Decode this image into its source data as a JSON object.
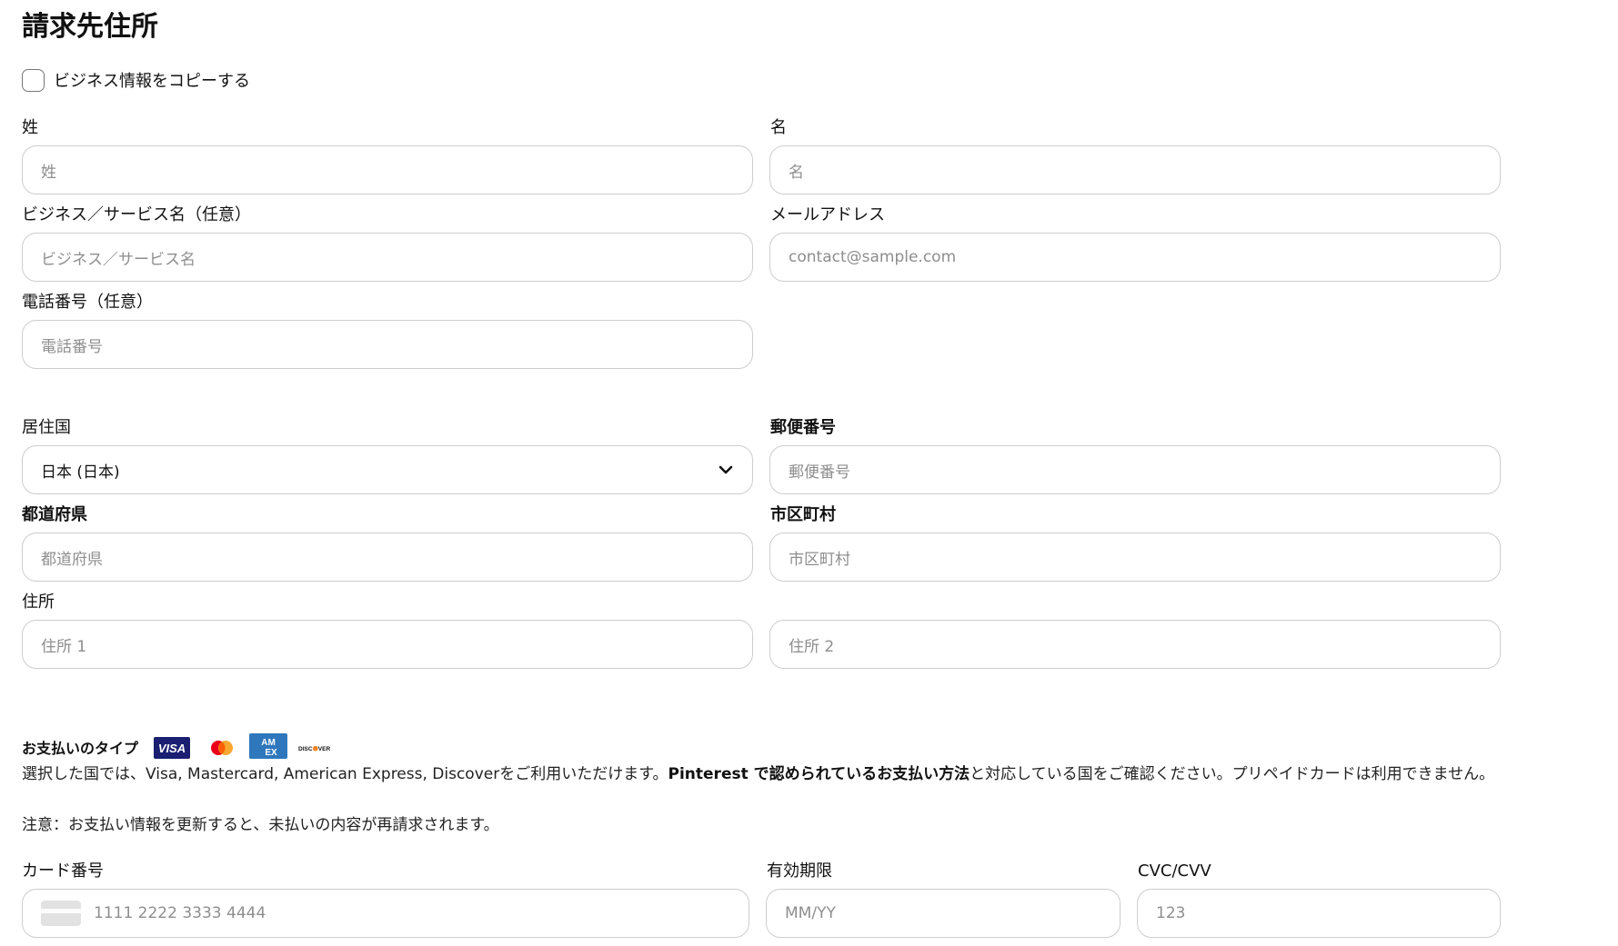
{
  "page": {
    "title": "請求先住所",
    "copy_business_checkbox": {
      "label": "ビジネス情報をコピーする",
      "checked": false
    }
  },
  "form": {
    "last_name": {
      "label": "姓",
      "placeholder": "姓"
    },
    "first_name": {
      "label": "名",
      "placeholder": "名"
    },
    "business_name": {
      "label": "ビジネス／サービス名（任意）",
      "placeholder": "ビジネス／サービス名"
    },
    "email": {
      "label": "メールアドレス",
      "placeholder": "contact@sample.com"
    },
    "phone": {
      "label": "電話番号（任意）",
      "placeholder": "電話番号"
    },
    "country": {
      "label": "居住国",
      "value": "日本 (日本)"
    },
    "postal_code": {
      "label": "郵便番号",
      "placeholder": "郵便番号"
    },
    "prefecture": {
      "label": "都道府県",
      "placeholder": "都道府県"
    },
    "city": {
      "label": "市区町村",
      "placeholder": "市区町村"
    },
    "address": {
      "label": "住所",
      "line1_placeholder": "住所 1",
      "line2_placeholder": "住所 2"
    }
  },
  "payment": {
    "title": "お支払いのタイプ",
    "card_brands": [
      {
        "name": "VISA",
        "icon": "visa-logo",
        "color": "#1a1f71"
      },
      {
        "name": "Mastercard",
        "icon": "mastercard-logo",
        "colors": [
          "#eb001b",
          "#f79e1b"
        ]
      },
      {
        "name": "AMEX",
        "icon": "amex-logo",
        "color": "#2e77bc"
      },
      {
        "name": "DISCOVER",
        "icon": "discover-logo",
        "color": "#111111"
      }
    ],
    "info_prefix": "選択した国では、Visa, Mastercard, American Express, Discoverをご利用いただけます。",
    "info_bold": "Pinterest で認められているお支払い方法",
    "info_suffix": "と対応している国をご確認ください。プリペイドカードは利用できません。",
    "note": "注意：お支払い情報を更新すると、未払いの内容が再請求されます。",
    "card_number": {
      "label": "カード番号",
      "placeholder": "1111 2222 3333 4444"
    },
    "expiry": {
      "label": "有効期限",
      "placeholder": "MM/YY"
    },
    "cvc": {
      "label": "CVC/CVV",
      "placeholder": "123"
    }
  }
}
